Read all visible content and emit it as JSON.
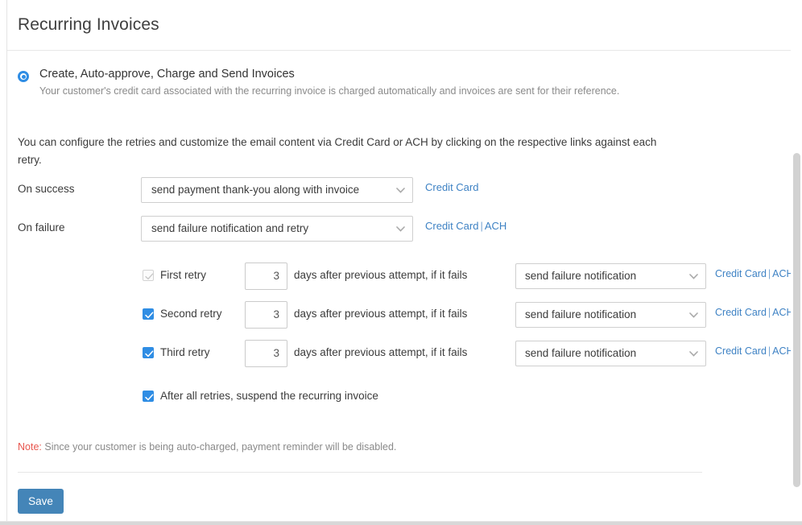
{
  "header": {
    "title": "Recurring Invoices"
  },
  "option": {
    "label": "Create, Auto-approve, Charge and Send Invoices",
    "description": "Your customer's credit card associated with the recurring invoice is charged automatically and invoices are sent for their reference.",
    "selected": true
  },
  "intro_text": "You can configure the retries and customize the email content via Credit Card or ACH by clicking on the respective links against each retry.",
  "on_success": {
    "label": "On success",
    "select_value": "send payment thank-you along with invoice",
    "links": [
      {
        "text": "Credit Card"
      }
    ]
  },
  "on_failure": {
    "label": "On failure",
    "select_value": "send failure notification and retry",
    "links": [
      {
        "text": "Credit Card"
      },
      {
        "separator": "|"
      },
      {
        "text": "ACH"
      }
    ]
  },
  "retries": [
    {
      "label": "First retry",
      "checked": true,
      "disabled": true,
      "days": "3",
      "days_suffix": "days after previous attempt, if it fails",
      "select_value": "send failure notification",
      "link_credit_card": "Credit Card",
      "link_separator": "|",
      "link_ach": "ACH"
    },
    {
      "label": "Second retry",
      "checked": true,
      "disabled": false,
      "days": "3",
      "days_suffix": "days after previous attempt, if it fails",
      "select_value": "send failure notification",
      "link_credit_card": "Credit Card",
      "link_separator": "|",
      "link_ach": "ACH"
    },
    {
      "label": "Third retry",
      "checked": true,
      "disabled": false,
      "days": "3",
      "days_suffix": "days after previous attempt, if it fails",
      "select_value": "send failure notification",
      "link_credit_card": "Credit Card",
      "link_separator": "|",
      "link_ach": "ACH"
    }
  ],
  "suspend": {
    "label": "After all retries, suspend the recurring invoice",
    "checked": true
  },
  "note": {
    "label": "Note:",
    "text": " Since your customer is being auto-charged, payment reminder will be disabled."
  },
  "footer": {
    "save_label": "Save"
  },
  "colors": {
    "accent_blue": "#2f8de4",
    "link_blue": "#3e82c4",
    "save_blue": "#4485b8",
    "note_red": "#e8554d",
    "scrollbar_thumb": "#d2d2d2"
  }
}
